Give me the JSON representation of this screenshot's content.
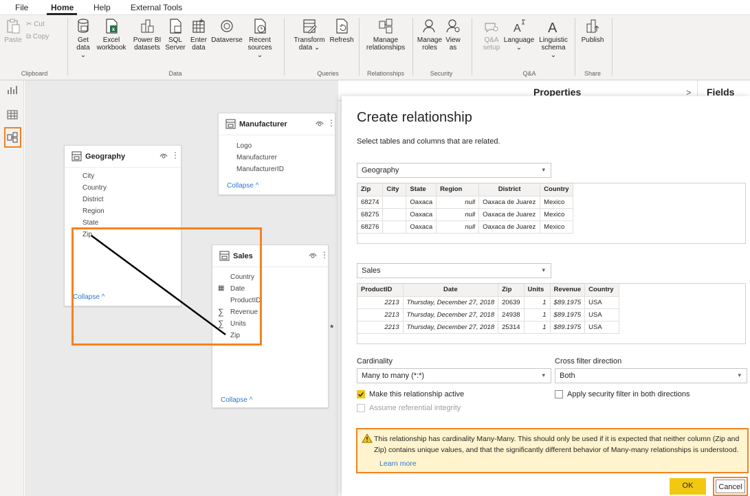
{
  "menubar": {
    "items": [
      "File",
      "Home",
      "Help",
      "External Tools"
    ]
  },
  "ribbon": {
    "clipboard": {
      "paste": "Paste",
      "cut": "Cut",
      "copy": "Copy",
      "group": "Clipboard"
    },
    "data": {
      "get_data": [
        "Get",
        "data ⌄"
      ],
      "excel": [
        "Excel",
        "workbook"
      ],
      "powerbi": [
        "Power BI",
        "datasets"
      ],
      "sql": [
        "SQL",
        "Server"
      ],
      "enter": [
        "Enter",
        "data"
      ],
      "dataverse": "Dataverse",
      "recent": [
        "Recent",
        "sources ⌄"
      ],
      "group": "Data"
    },
    "queries": {
      "transform": [
        "Transform",
        "data ⌄"
      ],
      "refresh": "Refresh",
      "group": "Queries"
    },
    "relationships": {
      "manage": [
        "Manage",
        "relationships"
      ],
      "group": "Relationships"
    },
    "security": {
      "manage_roles": [
        "Manage",
        "roles"
      ],
      "view_as": [
        "View",
        "as"
      ],
      "group": "Security"
    },
    "qa": {
      "setup": [
        "Q&A",
        "setup"
      ],
      "language": [
        "Language",
        "⌄"
      ],
      "linguistic": [
        "Linguistic",
        "schema ⌄"
      ],
      "group": "Q&A"
    },
    "share": {
      "publish": "Publish",
      "group": "Share"
    }
  },
  "panes": {
    "properties": "Properties",
    "fields": "Fields",
    "chevron": ">"
  },
  "canvas": {
    "collapse": "Collapse",
    "manufacturer": {
      "title": "Manufacturer",
      "fields": [
        "Logo",
        "Manufacturer",
        "ManufacturerID"
      ]
    },
    "geography": {
      "title": "Geography",
      "fields": [
        "City",
        "Country",
        "District",
        "Region",
        "State",
        "Zip"
      ]
    },
    "sales": {
      "title": "Sales",
      "fields": [
        "Country",
        "Date",
        "ProductID",
        "Revenue",
        "Units",
        "Zip"
      ]
    },
    "many_marker": "*"
  },
  "dialog": {
    "title": "Create relationship",
    "subtitle": "Select tables and columns that are related.",
    "table1": {
      "selected": "Geography",
      "columns": [
        "Zip",
        "City",
        "State",
        "Region",
        "District",
        "Country"
      ],
      "rows": [
        [
          "68274",
          "",
          "Oaxaca",
          "null",
          "Oaxaca de Juarez",
          "Mexico"
        ],
        [
          "68275",
          "",
          "Oaxaca",
          "null",
          "Oaxaca de Juarez",
          "Mexico"
        ],
        [
          "68276",
          "",
          "Oaxaca",
          "null",
          "Oaxaca de Juarez",
          "Mexico"
        ]
      ]
    },
    "table2": {
      "selected": "Sales",
      "columns": [
        "ProductID",
        "Date",
        "Zip",
        "Units",
        "Revenue",
        "Country"
      ],
      "rows": [
        [
          "2213",
          "Thursday, December 27, 2018",
          "20639",
          "1",
          "$89.1975",
          "USA"
        ],
        [
          "2213",
          "Thursday, December 27, 2018",
          "24938",
          "1",
          "$89.1975",
          "USA"
        ],
        [
          "2213",
          "Thursday, December 27, 2018",
          "25314",
          "1",
          "$89.1975",
          "USA"
        ]
      ]
    },
    "cardinality": {
      "label": "Cardinality",
      "value": "Many to many (*:*)"
    },
    "crossfilter": {
      "label": "Cross filter direction",
      "value": "Both"
    },
    "make_active": {
      "label": "Make this relationship active",
      "checked": true
    },
    "security_filter": {
      "label": "Apply security filter in both directions",
      "checked": false
    },
    "referential": {
      "label": "Assume referential integrity",
      "checked": false
    },
    "warning": {
      "text": "This relationship has cardinality Many-Many. This should only be used if it is expected that neither column (Zip and Zip) contains unique values, and that the significantly different behavior of Many-many relationships is understood.",
      "link": "Learn more"
    },
    "ok": "OK",
    "cancel": "Cancel"
  },
  "colors": {
    "accent_yellow": "#f2c811",
    "highlight_orange": "#f5821f",
    "link_blue": "#2b79d0"
  }
}
